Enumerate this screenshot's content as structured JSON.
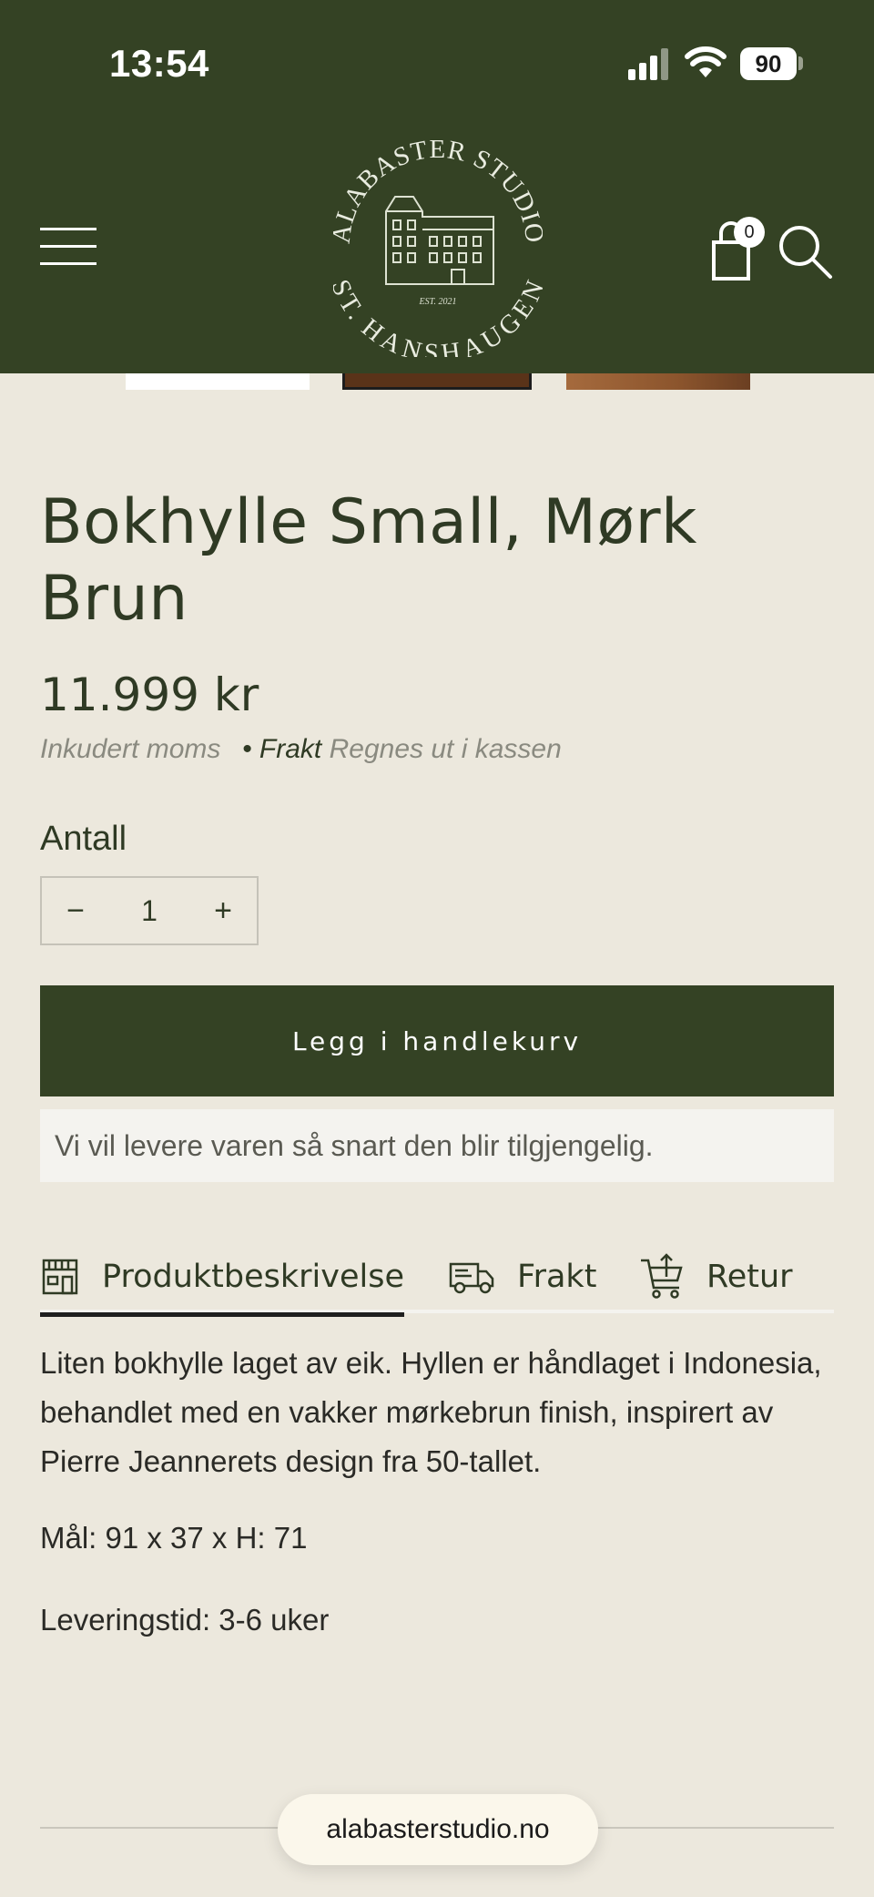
{
  "status_bar": {
    "time": "13:54",
    "battery": "90",
    "icons": [
      "signal-icon",
      "wifi-icon",
      "battery-icon"
    ]
  },
  "header": {
    "logo": {
      "name": "ALABASTER STUDIO",
      "location": "ST. HANSHAUGEN",
      "established": "EST. 2021"
    },
    "cart_count": "0",
    "icons": [
      "menu-icon",
      "cart-icon",
      "search-icon"
    ]
  },
  "product": {
    "title": "Bokhylle Small, Mørk Brun",
    "price": "11.999 kr",
    "tax_note": "Inkudert moms",
    "shipping_label": "Frakt",
    "shipping_note": "Regnes ut i kassen",
    "quantity_label": "Antall",
    "quantity_value": "1",
    "decrement": "−",
    "increment": "+",
    "add_to_cart": "Legg i handlekurv",
    "availability_notice": "Vi vil levere varen så snart den blir tilgjengelig."
  },
  "tabs": [
    {
      "label": "Produktbeskrivelse",
      "icon": "store-icon",
      "active": true
    },
    {
      "label": "Frakt",
      "icon": "truck-icon",
      "active": false
    },
    {
      "label": "Retur",
      "icon": "return-cart-icon",
      "active": false
    }
  ],
  "description": {
    "text": "Liten bokhylle laget av eik. Hyllen er håndlaget i Indonesia, behandlet med en vakker mørkebrun finish, inspirert av Pierre Jeannerets design fra 50-tallet.",
    "measurements": "Mål: 91 x 37 x H: 71",
    "delivery_time": "Leveringstid: 3-6 uker"
  },
  "browser": {
    "url": "alabasterstudio.no"
  },
  "colors": {
    "brand_green": "#344224",
    "background": "#ece8dd",
    "text_dark": "#2f3a24",
    "muted_text": "#8a8a80"
  }
}
